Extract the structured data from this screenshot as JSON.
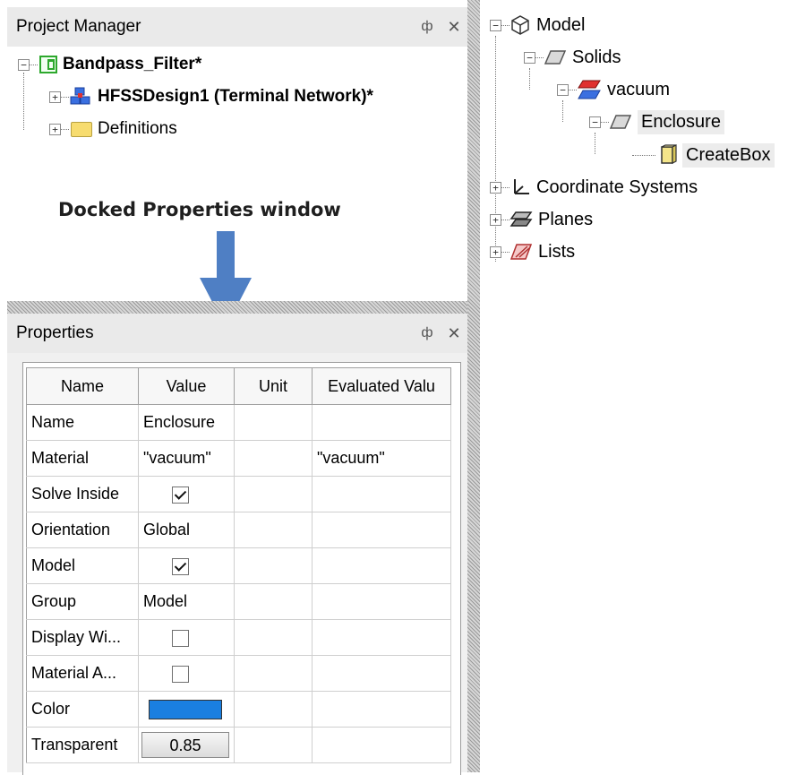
{
  "project_manager": {
    "title": "Project Manager",
    "pin_glyph": "ф",
    "close_glyph": "✕",
    "tree": [
      {
        "label": "Bandpass_Filter*",
        "expander": "−",
        "icon": "project-icon"
      },
      {
        "label": "HFSSDesign1 (Terminal Network)*",
        "expander": "+",
        "icon": "hfss-design-icon"
      },
      {
        "label": "Definitions",
        "expander": "+",
        "icon": "folder-icon"
      }
    ]
  },
  "annotation": {
    "text": "Docked Properties window"
  },
  "properties": {
    "title": "Properties",
    "pin_glyph": "ф",
    "close_glyph": "✕",
    "columns": [
      "Name",
      "Value",
      "Unit",
      "Evaluated Valu"
    ],
    "rows": [
      {
        "name": "Name",
        "value": "Enclosure",
        "unit": "",
        "evaluated": ""
      },
      {
        "name": "Material",
        "value": "\"vacuum\"",
        "unit": "",
        "evaluated": "\"vacuum\""
      },
      {
        "name": "Solve Inside",
        "checkbox": true,
        "unit": "",
        "evaluated": ""
      },
      {
        "name": "Orientation",
        "value": "Global",
        "unit": "",
        "evaluated": ""
      },
      {
        "name": "Model",
        "checkbox": true,
        "unit": "",
        "evaluated": ""
      },
      {
        "name": "Group",
        "value": "Model",
        "unit": "",
        "evaluated": ""
      },
      {
        "name": "Display Wi...",
        "checkbox": false,
        "unit": "",
        "evaluated": ""
      },
      {
        "name": "Material A...",
        "checkbox": false,
        "unit": "",
        "evaluated": ""
      },
      {
        "name": "Color",
        "color": "#1a7fe0",
        "unit": "",
        "evaluated": ""
      },
      {
        "name": "Transparent",
        "spin": "0.85",
        "unit": "",
        "evaluated": ""
      }
    ]
  },
  "model_tree": {
    "items": [
      {
        "label": "Model",
        "expander": "−",
        "icon": "model-icon"
      },
      {
        "label": "Solids",
        "expander": "−",
        "icon": "solids-icon"
      },
      {
        "label": "vacuum",
        "expander": "−",
        "icon": "material-icon"
      },
      {
        "label": "Enclosure",
        "expander": "−",
        "icon": "object-icon"
      },
      {
        "label": "CreateBox",
        "icon": "create-box-icon"
      },
      {
        "label": "Coordinate Systems",
        "expander": "+",
        "icon": "coordinate-systems-icon"
      },
      {
        "label": "Planes",
        "expander": "+",
        "icon": "planes-icon"
      },
      {
        "label": "Lists",
        "expander": "+",
        "icon": "lists-icon"
      }
    ]
  },
  "colors": {
    "arrow": "#4f7fc4",
    "color_swatch": "#1a7fe0",
    "material_color": "#e03030"
  }
}
